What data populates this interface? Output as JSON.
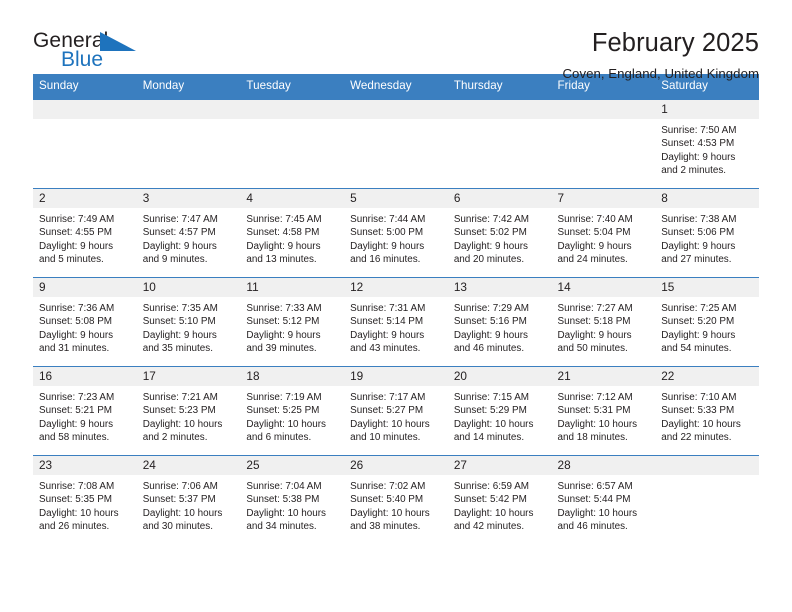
{
  "brand": {
    "word_one": "General",
    "word_two": "Blue",
    "triangle_icon": "triangle-logo-icon",
    "accent_color": "#1e73bd"
  },
  "header": {
    "title": "February 2025",
    "subtitle": "Coven, England, United Kingdom"
  },
  "colors": {
    "header_blue": "#3b7fc0",
    "daynum_band": "#f0f0f0",
    "text": "#231f20"
  },
  "weekday_headers": [
    "Sunday",
    "Monday",
    "Tuesday",
    "Wednesday",
    "Thursday",
    "Friday",
    "Saturday"
  ],
  "labels": {
    "sunrise": "Sunrise:",
    "sunset": "Sunset:",
    "daylight": "Daylight:"
  },
  "weeks": [
    [
      {
        "day": ""
      },
      {
        "day": ""
      },
      {
        "day": ""
      },
      {
        "day": ""
      },
      {
        "day": ""
      },
      {
        "day": ""
      },
      {
        "day": "1",
        "sunrise": "Sunrise: 7:50 AM",
        "sunset": "Sunset: 4:53 PM",
        "daylight": "Daylight: 9 hours and 2 minutes."
      }
    ],
    [
      {
        "day": "2",
        "sunrise": "Sunrise: 7:49 AM",
        "sunset": "Sunset: 4:55 PM",
        "daylight": "Daylight: 9 hours and 5 minutes."
      },
      {
        "day": "3",
        "sunrise": "Sunrise: 7:47 AM",
        "sunset": "Sunset: 4:57 PM",
        "daylight": "Daylight: 9 hours and 9 minutes."
      },
      {
        "day": "4",
        "sunrise": "Sunrise: 7:45 AM",
        "sunset": "Sunset: 4:58 PM",
        "daylight": "Daylight: 9 hours and 13 minutes."
      },
      {
        "day": "5",
        "sunrise": "Sunrise: 7:44 AM",
        "sunset": "Sunset: 5:00 PM",
        "daylight": "Daylight: 9 hours and 16 minutes."
      },
      {
        "day": "6",
        "sunrise": "Sunrise: 7:42 AM",
        "sunset": "Sunset: 5:02 PM",
        "daylight": "Daylight: 9 hours and 20 minutes."
      },
      {
        "day": "7",
        "sunrise": "Sunrise: 7:40 AM",
        "sunset": "Sunset: 5:04 PM",
        "daylight": "Daylight: 9 hours and 24 minutes."
      },
      {
        "day": "8",
        "sunrise": "Sunrise: 7:38 AM",
        "sunset": "Sunset: 5:06 PM",
        "daylight": "Daylight: 9 hours and 27 minutes."
      }
    ],
    [
      {
        "day": "9",
        "sunrise": "Sunrise: 7:36 AM",
        "sunset": "Sunset: 5:08 PM",
        "daylight": "Daylight: 9 hours and 31 minutes."
      },
      {
        "day": "10",
        "sunrise": "Sunrise: 7:35 AM",
        "sunset": "Sunset: 5:10 PM",
        "daylight": "Daylight: 9 hours and 35 minutes."
      },
      {
        "day": "11",
        "sunrise": "Sunrise: 7:33 AM",
        "sunset": "Sunset: 5:12 PM",
        "daylight": "Daylight: 9 hours and 39 minutes."
      },
      {
        "day": "12",
        "sunrise": "Sunrise: 7:31 AM",
        "sunset": "Sunset: 5:14 PM",
        "daylight": "Daylight: 9 hours and 43 minutes."
      },
      {
        "day": "13",
        "sunrise": "Sunrise: 7:29 AM",
        "sunset": "Sunset: 5:16 PM",
        "daylight": "Daylight: 9 hours and 46 minutes."
      },
      {
        "day": "14",
        "sunrise": "Sunrise: 7:27 AM",
        "sunset": "Sunset: 5:18 PM",
        "daylight": "Daylight: 9 hours and 50 minutes."
      },
      {
        "day": "15",
        "sunrise": "Sunrise: 7:25 AM",
        "sunset": "Sunset: 5:20 PM",
        "daylight": "Daylight: 9 hours and 54 minutes."
      }
    ],
    [
      {
        "day": "16",
        "sunrise": "Sunrise: 7:23 AM",
        "sunset": "Sunset: 5:21 PM",
        "daylight": "Daylight: 9 hours and 58 minutes."
      },
      {
        "day": "17",
        "sunrise": "Sunrise: 7:21 AM",
        "sunset": "Sunset: 5:23 PM",
        "daylight": "Daylight: 10 hours and 2 minutes."
      },
      {
        "day": "18",
        "sunrise": "Sunrise: 7:19 AM",
        "sunset": "Sunset: 5:25 PM",
        "daylight": "Daylight: 10 hours and 6 minutes."
      },
      {
        "day": "19",
        "sunrise": "Sunrise: 7:17 AM",
        "sunset": "Sunset: 5:27 PM",
        "daylight": "Daylight: 10 hours and 10 minutes."
      },
      {
        "day": "20",
        "sunrise": "Sunrise: 7:15 AM",
        "sunset": "Sunset: 5:29 PM",
        "daylight": "Daylight: 10 hours and 14 minutes."
      },
      {
        "day": "21",
        "sunrise": "Sunrise: 7:12 AM",
        "sunset": "Sunset: 5:31 PM",
        "daylight": "Daylight: 10 hours and 18 minutes."
      },
      {
        "day": "22",
        "sunrise": "Sunrise: 7:10 AM",
        "sunset": "Sunset: 5:33 PM",
        "daylight": "Daylight: 10 hours and 22 minutes."
      }
    ],
    [
      {
        "day": "23",
        "sunrise": "Sunrise: 7:08 AM",
        "sunset": "Sunset: 5:35 PM",
        "daylight": "Daylight: 10 hours and 26 minutes."
      },
      {
        "day": "24",
        "sunrise": "Sunrise: 7:06 AM",
        "sunset": "Sunset: 5:37 PM",
        "daylight": "Daylight: 10 hours and 30 minutes."
      },
      {
        "day": "25",
        "sunrise": "Sunrise: 7:04 AM",
        "sunset": "Sunset: 5:38 PM",
        "daylight": "Daylight: 10 hours and 34 minutes."
      },
      {
        "day": "26",
        "sunrise": "Sunrise: 7:02 AM",
        "sunset": "Sunset: 5:40 PM",
        "daylight": "Daylight: 10 hours and 38 minutes."
      },
      {
        "day": "27",
        "sunrise": "Sunrise: 6:59 AM",
        "sunset": "Sunset: 5:42 PM",
        "daylight": "Daylight: 10 hours and 42 minutes."
      },
      {
        "day": "28",
        "sunrise": "Sunrise: 6:57 AM",
        "sunset": "Sunset: 5:44 PM",
        "daylight": "Daylight: 10 hours and 46 minutes."
      },
      {
        "day": ""
      }
    ]
  ]
}
